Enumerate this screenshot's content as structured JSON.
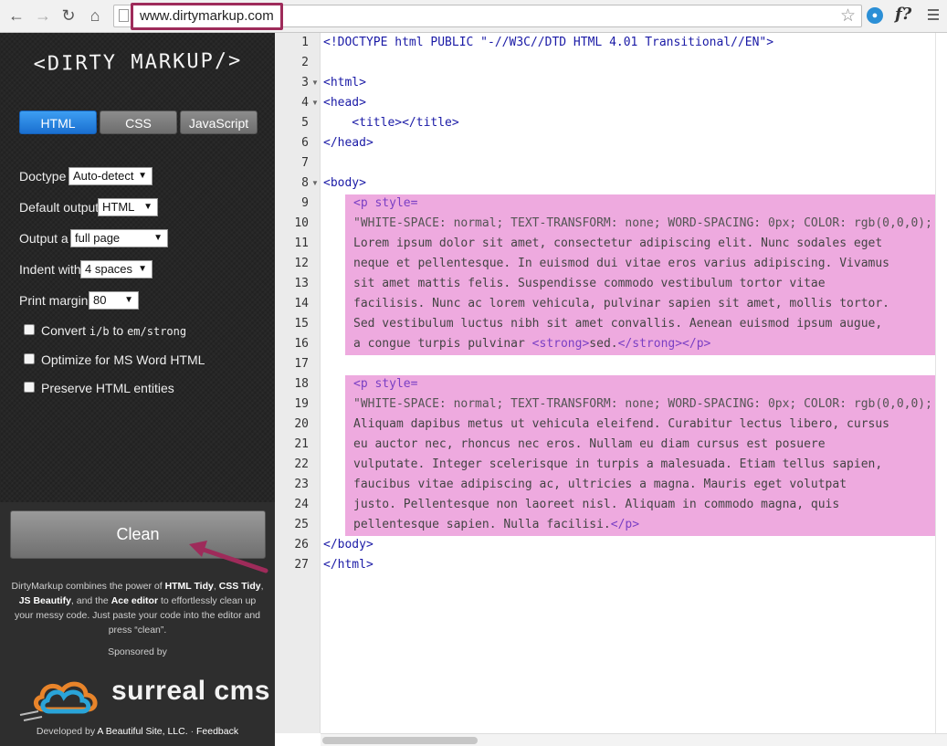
{
  "browser": {
    "url": "www.dirtymarkup.com",
    "back_icon": "arrow-left-icon",
    "forward_icon": "arrow-right-icon",
    "reload_icon": "reload-icon",
    "home_icon": "home-icon",
    "ext_f_label": "f?"
  },
  "sidebar": {
    "logo": "<DIRTY MARKUP/>",
    "tabs": [
      {
        "label": "HTML",
        "active": true
      },
      {
        "label": "CSS",
        "active": false
      },
      {
        "label": "JavaScript",
        "active": false
      }
    ],
    "options": {
      "doctype": {
        "label": "Doctype",
        "value": "Auto-detect"
      },
      "default_output": {
        "label": "Default output",
        "value": "HTML"
      },
      "output_a": {
        "label": "Output a",
        "value": "full page"
      },
      "indent_with": {
        "label": "Indent with",
        "value": "4 spaces"
      },
      "print_margin": {
        "label": "Print margin",
        "value": "80"
      }
    },
    "checkboxes": {
      "convert_prefix": "Convert",
      "convert_code1": "i/b",
      "convert_to": "to",
      "convert_code2": "em/strong",
      "optimize": "Optimize for MS Word HTML",
      "preserve": "Preserve HTML entities"
    },
    "clean_button": "Clean",
    "description": {
      "p1": "DirtyMarkup combines the power of",
      "html_tidy": "HTML Tidy",
      "css_tidy": "CSS Tidy",
      "js_beautify": "JS Beautify",
      "p2": ", and the",
      "ace": "Ace editor",
      "p3": "to effortlessly clean up your messy code. Just paste your code into the editor and press “clean”."
    },
    "sponsored_by": "Sponsored by",
    "sponsor_name": "surreal cms",
    "developed_by": "Developed by",
    "developer": "A Beautiful Site, LLC.",
    "separator": "·",
    "feedback": "Feedback"
  },
  "editor": {
    "line_numbers": [
      "1",
      "2",
      "3",
      "4",
      "5",
      "6",
      "7",
      "8",
      "9",
      "10",
      "11",
      "12",
      "13",
      "14",
      "15",
      "16",
      "17",
      "18",
      "19",
      "20",
      "21",
      "22",
      "23",
      "24",
      "25",
      "26",
      "27"
    ],
    "lines": {
      "l1": "<!DOCTYPE html PUBLIC \"-//W3C//DTD HTML 4.01 Transitional//EN\">",
      "l3": "<html>",
      "l4": "<head>",
      "l5": "    <title></title>",
      "l6": "</head>",
      "l8": "<body>",
      "l9": "<p style=",
      "l10": "\"WHITE-SPACE: normal; TEXT-TRANSFORM: none; WORD-SPACING: 0px; COLOR: rgb(0,0,0);",
      "l11": "Lorem ipsum dolor sit amet, consectetur adipiscing elit. Nunc sodales eget",
      "l12": "neque et pellentesque. In euismod dui vitae eros varius adipiscing. Vivamus",
      "l13": "sit amet mattis felis. Suspendisse commodo vestibulum tortor vitae",
      "l14": "facilisis. Nunc ac lorem vehicula, pulvinar sapien sit amet, mollis tortor.",
      "l15": "Sed vestibulum luctus nibh sit amet convallis. Aenean euismod ipsum augue,",
      "l16_text": "a congue turpis pulvinar ",
      "l16_open": "<strong>",
      "l16_mid": "sed.",
      "l16_close": "</strong></p>",
      "l18": "<p style=",
      "l19": "\"WHITE-SPACE: normal; TEXT-TRANSFORM: none; WORD-SPACING: 0px; COLOR: rgb(0,0,0);",
      "l20": "Aliquam dapibus metus ut vehicula eleifend. Curabitur lectus libero, cursus",
      "l21": "eu auctor nec, rhoncus nec eros. Nullam eu diam cursus est posuere",
      "l22": "vulputate. Integer scelerisque in turpis a malesuada. Etiam tellus sapien,",
      "l23": "faucibus vitae adipiscing ac, ultricies a magna. Mauris eget volutpat",
      "l24": "justo. Pellentesque non laoreet nisl. Aliquam in commodo magna, quis",
      "l25_text": "pellentesque sapien. Nulla facilisi.",
      "l25_close": "</p>",
      "l26": "</body>",
      "l27": "</html>"
    }
  },
  "colors": {
    "highlight": "#eeaadf",
    "annotation": "#9e2b5a",
    "active_tab": "#2680e0"
  }
}
